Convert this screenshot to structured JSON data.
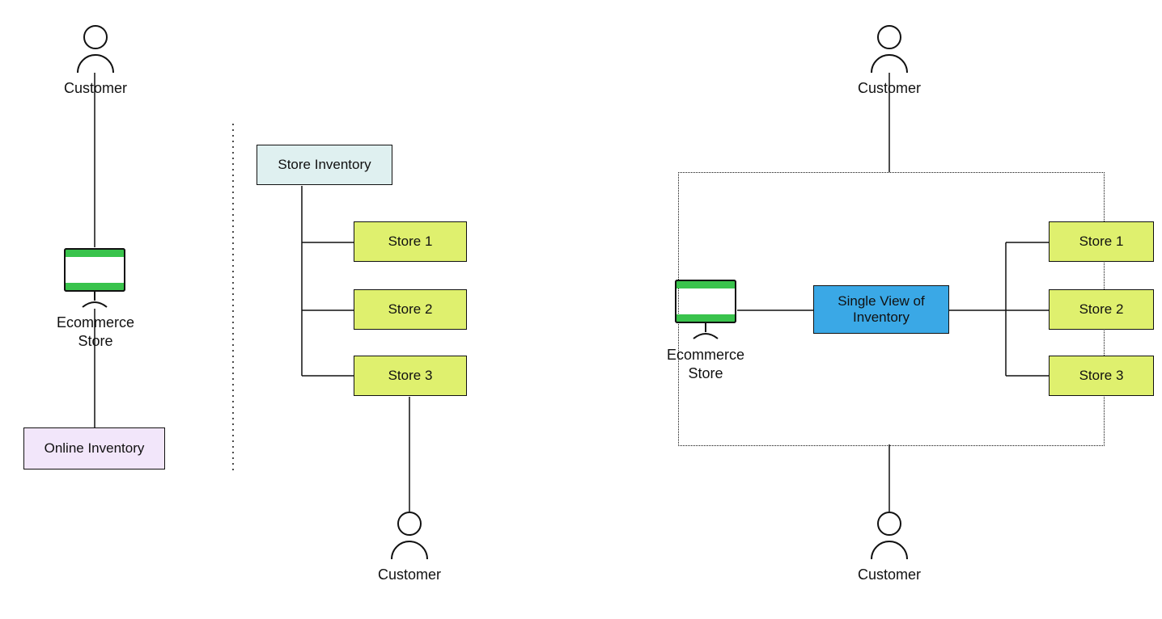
{
  "left": {
    "customer_top_label": "Customer",
    "ecom_label": "Ecommerce\nStore",
    "online_inventory": "Online Inventory",
    "store_inventory": "Store Inventory",
    "store1": "Store 1",
    "store2": "Store 2",
    "store3": "Store 3",
    "customer_bottom_label": "Customer"
  },
  "right": {
    "customer_top_label": "Customer",
    "ecom_label": "Ecommerce\nStore",
    "single_view": "Single View of\nInventory",
    "store1": "Store 1",
    "store2": "Store 2",
    "store3": "Store 3",
    "customer_bottom_label": "Customer"
  }
}
